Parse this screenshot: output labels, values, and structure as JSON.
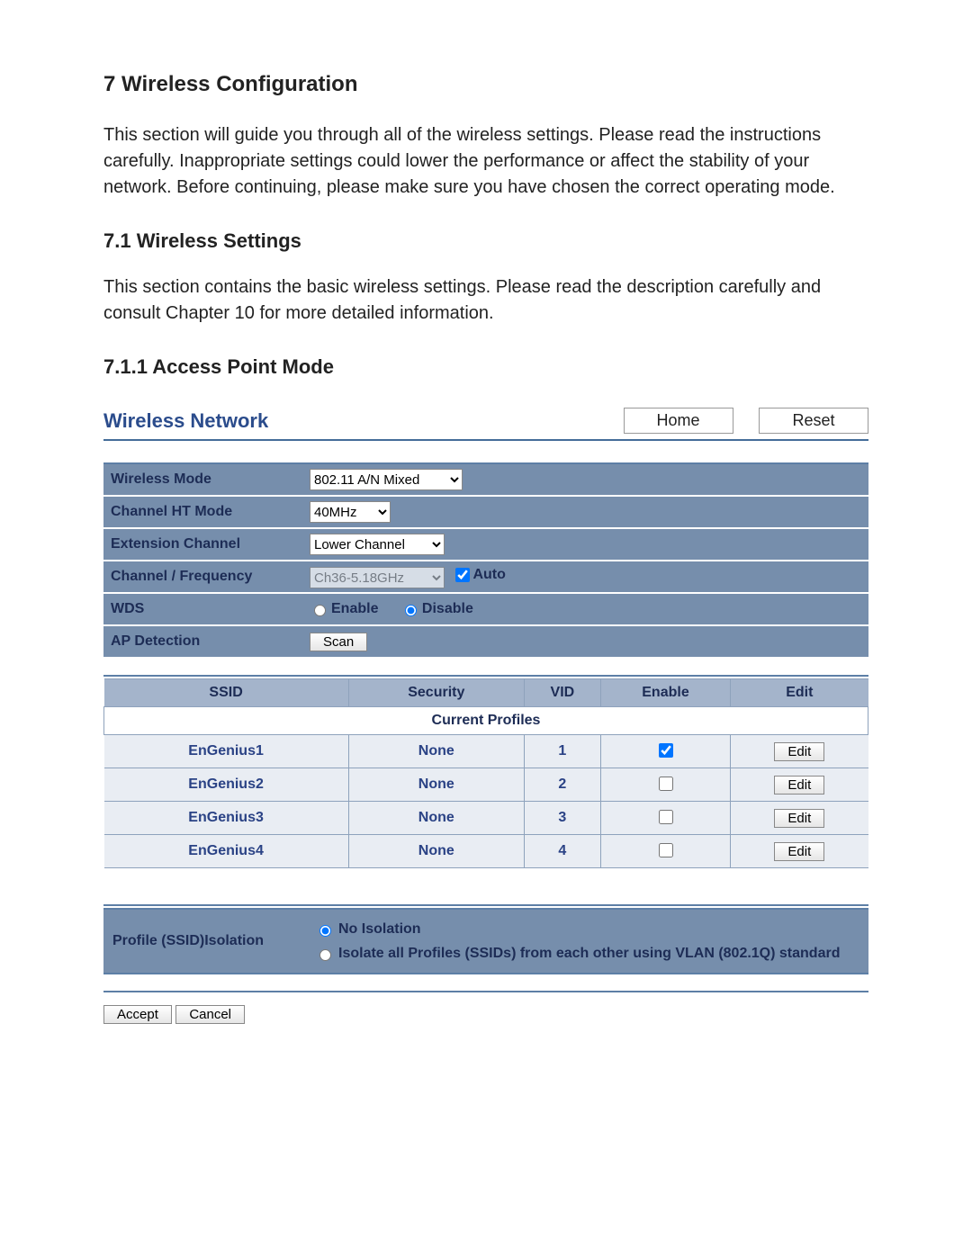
{
  "doc": {
    "h1": "7 Wireless Configuration",
    "p1": "This section will guide you through all of the wireless settings. Please read the instructions carefully. Inappropriate settings could lower the performance or affect the stability of your network. Before continuing, please make sure you have chosen the correct operating mode.",
    "h2": "7.1 Wireless Settings",
    "p2": "This section contains the basic wireless settings. Please read the description carefully and consult Chapter 10 for more detailed information.",
    "h3": "7.1.1 Access Point Mode"
  },
  "panel": {
    "title": "Wireless Network",
    "home": "Home",
    "reset": "Reset"
  },
  "settings": {
    "rows": {
      "wireless_mode": {
        "label": "Wireless Mode",
        "value": "802.11 A/N Mixed"
      },
      "ht_mode": {
        "label": "Channel HT Mode",
        "value": "40MHz"
      },
      "ext_channel": {
        "label": "Extension Channel",
        "value": "Lower Channel"
      },
      "chan_freq": {
        "label": "Channel / Frequency",
        "value": "Ch36-5.18GHz",
        "auto_label": "Auto",
        "auto_checked": true
      },
      "wds": {
        "label": "WDS",
        "enable": "Enable",
        "disable": "Disable",
        "selected": "disable"
      },
      "ap_detect": {
        "label": "AP Detection",
        "button": "Scan"
      }
    }
  },
  "profiles": {
    "caption": "Current Profiles",
    "headers": {
      "ssid": "SSID",
      "security": "Security",
      "vid": "VID",
      "enable": "Enable",
      "edit": "Edit"
    },
    "edit_label": "Edit",
    "rows": [
      {
        "ssid": "EnGenius1",
        "security": "None",
        "vid": "1",
        "enabled": true
      },
      {
        "ssid": "EnGenius2",
        "security": "None",
        "vid": "2",
        "enabled": false
      },
      {
        "ssid": "EnGenius3",
        "security": "None",
        "vid": "3",
        "enabled": false
      },
      {
        "ssid": "EnGenius4",
        "security": "None",
        "vid": "4",
        "enabled": false
      }
    ]
  },
  "isolation": {
    "label": "Profile (SSID)Isolation",
    "opt_none": "No Isolation",
    "opt_vlan": "Isolate all Profiles (SSIDs) from each other using VLAN (802.1Q) standard",
    "selected": "none"
  },
  "footer": {
    "accept": "Accept",
    "cancel": "Cancel"
  }
}
